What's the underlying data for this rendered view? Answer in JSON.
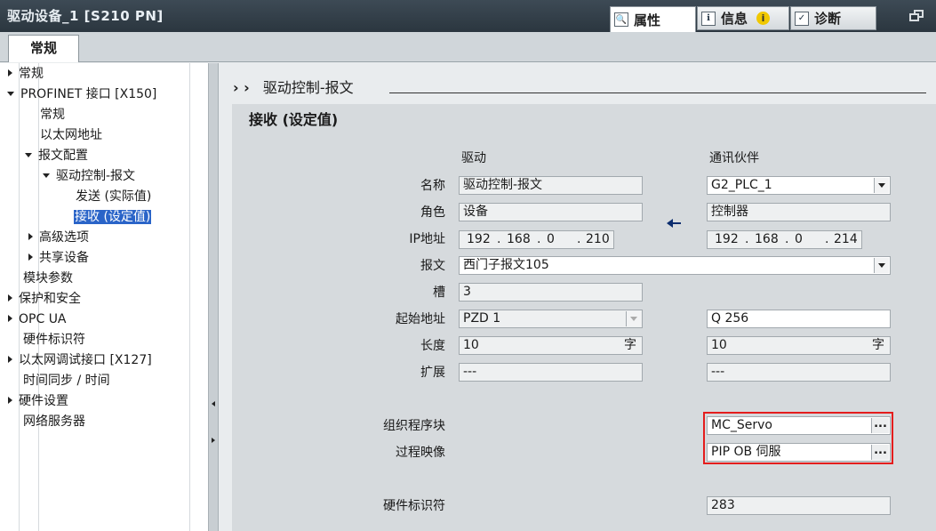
{
  "window": {
    "title": "驱动设备_1 [S210 PN]"
  },
  "top_tabs": {
    "properties": "属性",
    "info": "信息",
    "diagnostics": "诊断",
    "info_badge": "i"
  },
  "sub_tab": {
    "general": "常规"
  },
  "nav": {
    "items": [
      {
        "label": "常规"
      },
      {
        "label": "PROFINET 接口 [X150]"
      },
      {
        "label": "常规"
      },
      {
        "label": "以太网地址"
      },
      {
        "label": "报文配置"
      },
      {
        "label": "驱动控制-报文"
      },
      {
        "label": "发送 (实际值)"
      },
      {
        "label": "接收 (设定值)"
      },
      {
        "label": "高级选项"
      },
      {
        "label": "共享设备"
      },
      {
        "label": "模块参数"
      },
      {
        "label": "保护和安全"
      },
      {
        "label": "OPC UA"
      },
      {
        "label": "硬件标识符"
      },
      {
        "label": "以太网调试接口 [X127]"
      },
      {
        "label": "时间同步 / 时间"
      },
      {
        "label": "硬件设置"
      },
      {
        "label": "网络服务器"
      }
    ]
  },
  "breadcrumb": {
    "text": "驱动控制-报文"
  },
  "section_title": "接收 (设定值)",
  "columns": {
    "drive": "驱动",
    "partner": "通讯伙伴"
  },
  "labels": {
    "name": "名称",
    "role": "角色",
    "ip": "IP地址",
    "telegram": "报文",
    "slot": "槽",
    "start_address": "起始地址",
    "length": "长度",
    "extension": "扩展",
    "org_block": "组织程序块",
    "process_image": "过程映像",
    "hw_id": "硬件标识符"
  },
  "drive": {
    "name": "驱动控制-报文",
    "role": "设备",
    "ip": [
      "192",
      "168",
      "0",
      "210"
    ],
    "telegram": "西门子报文105",
    "slot": "3",
    "start_address": "PZD 1",
    "length": "10",
    "length_unit": "字",
    "extension": "---"
  },
  "partner": {
    "name": "G2_PLC_1",
    "role": "控制器",
    "ip": [
      "192",
      "168",
      "0",
      "214"
    ],
    "start_address": "Q 256",
    "length": "10",
    "length_unit": "字",
    "extension": "---",
    "org_block": "MC_Servo",
    "process_image": "PIP OB 伺服",
    "hw_id": "283"
  },
  "browse_label": "..."
}
